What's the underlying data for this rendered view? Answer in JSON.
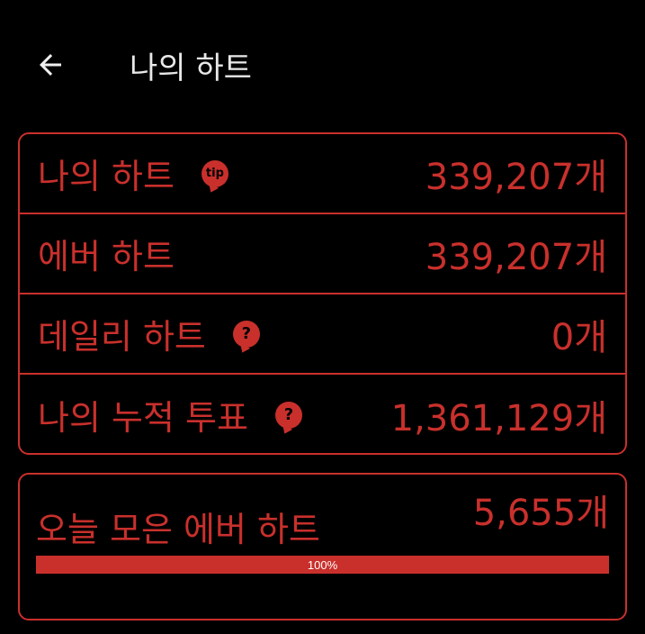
{
  "header": {
    "title": "나의 하트"
  },
  "stats": [
    {
      "label": "나의 하트",
      "value": "339,207개",
      "badge": "tip",
      "badge_icon": "tip-icon"
    },
    {
      "label": "에버 하트",
      "value": "339,207개"
    },
    {
      "label": "데일리 하트",
      "value": "0개",
      "badge": "?",
      "badge_icon": "help-icon"
    },
    {
      "label": "나의 누적 투표",
      "value": "1,361,129개",
      "badge": "?",
      "badge_icon": "help-icon"
    }
  ],
  "today": {
    "label": "오늘 모은 에버 하트",
    "value": "5,655개",
    "progress_text": "100%",
    "progress": 1.0
  },
  "colors": {
    "accent": "#c9302c",
    "background": "#000000",
    "title_text": "#e8e8e8"
  }
}
